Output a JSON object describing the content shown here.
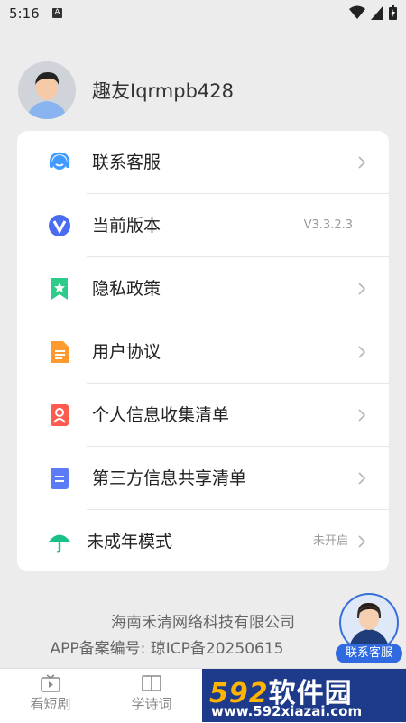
{
  "status_bar": {
    "time": "5:16",
    "a_label": "A"
  },
  "profile": {
    "username": "趣友Iqrmpb428"
  },
  "menu": [
    {
      "label": "联系客服",
      "value": "",
      "icon": "headset-icon",
      "color": "#3f9bff"
    },
    {
      "label": "当前版本",
      "value": "V3.3.2.3",
      "icon": "version-v-icon",
      "color": "#4a6cf0"
    },
    {
      "label": "隐私政策",
      "value": "",
      "icon": "bookmark-star-icon",
      "color": "#2ecc8a"
    },
    {
      "label": "用户协议",
      "value": "",
      "icon": "document-icon",
      "color": "#ff9a2e"
    },
    {
      "label": "个人信息收集清单",
      "value": "",
      "icon": "person-card-icon",
      "color": "#ff5a4e"
    },
    {
      "label": "第三方信息共享清单",
      "value": "",
      "icon": "shared-document-icon",
      "color": "#5b7cf5"
    },
    {
      "label": "未成年模式",
      "value": "未开启",
      "icon": "umbrella-icon",
      "color": "#18c08a"
    }
  ],
  "footer": {
    "company": "海南禾清网络科技有限公司",
    "icp": "APP备案编号: 琼ICP备20250615"
  },
  "tabs": [
    {
      "label": "看短剧",
      "icon": "tv-icon"
    },
    {
      "label": "学诗词",
      "icon": "book-icon"
    }
  ],
  "support_float": {
    "label": "联系客服"
  },
  "watermark": {
    "brand_num": "592",
    "brand_text": "软件园",
    "url": "www.592xiazai.com"
  }
}
